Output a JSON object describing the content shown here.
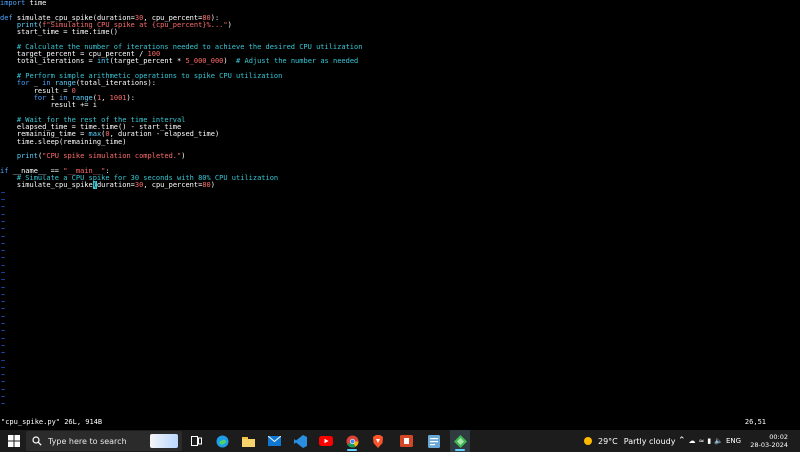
{
  "editor": {
    "code": [
      "import time",
      "",
      "def simulate_cpu_spike(duration=30, cpu_percent=80):",
      "    print(f\"Simulating CPU spike at {cpu_percent}%...\")",
      "    start_time = time.time()",
      "",
      "    # Calculate the number of iterations needed to achieve the desired CPU utilization",
      "    target_percent = cpu_percent / 100",
      "    total_iterations = int(target_percent * 5_000_000)  # Adjust the number as needed",
      "",
      "    # Perform simple arithmetic operations to spike CPU utilization",
      "    for _ in range(total_iterations):",
      "        result = 0",
      "        for i in range(1, 1001):",
      "            result += i",
      "",
      "    # Wait for the rest of the time interval",
      "    elapsed_time = time.time() - start_time",
      "    remaining_time = max(0, duration - elapsed_time)",
      "    time.sleep(remaining_time)",
      "",
      "    print(\"CPU spike simulation completed.\")",
      "",
      "if __name__ == \"__main__\":",
      "    # Simulate a CPU spike for 30 seconds with 80% CPU utilization",
      "    simulate_cpu_spike(duration=30, cpu_percent=80)"
    ],
    "cursor": {
      "line": 26,
      "col": 51
    },
    "empty_marker": "~",
    "empty_lines": 30
  },
  "statusline": {
    "file_info": "\"cpu_spike.py\" 26L, 914B",
    "position": "26,51"
  },
  "taskbar": {
    "search_placeholder": "Type here to search",
    "weather_temp": "29°C",
    "weather_text": "Partly cloudy",
    "language": "ENG",
    "time": "00:02",
    "date": "28-03-2024",
    "accent": "#60cdff"
  }
}
